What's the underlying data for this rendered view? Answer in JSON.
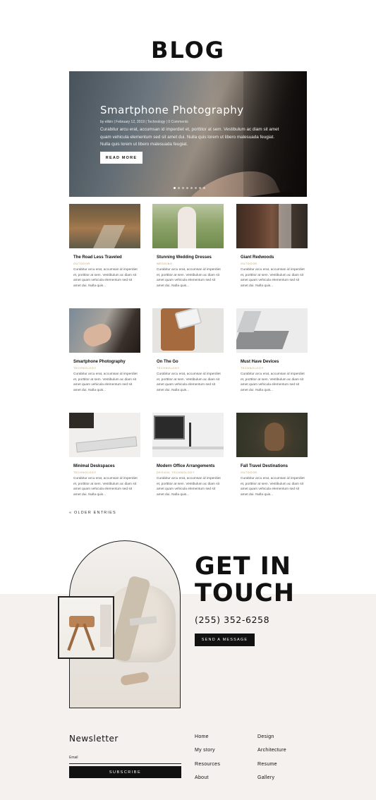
{
  "page_title": "BLOG",
  "hero": {
    "title": "Smartphone Photography",
    "meta": "by elikin | February 12, 2019 | Technology | 0 Comments",
    "excerpt": "Curabitur arcu erat, accumsan id imperdiet et, porttitor at sem. Vestibulum ac diam sit amet quam vehicula elementum sed sit amet dui. Nulla quis lorem ut libero malesuada feugiat. Nulla quis lorem ut libero malesuada feugiat.",
    "button_label": "READ MORE",
    "slide_count": 8,
    "active_slide": 1
  },
  "posts": [
    {
      "title": "The Road Less Traveled",
      "category": "OUTDOOR",
      "excerpt": "Curabitur arcu erat, accumsan id imperdiet et, porttitor at sem. Vestibulum ac diam sit amet quam vehicula elementum sed sit amet dui. Nulla quis..."
    },
    {
      "title": "Stunning Wedding Dresses",
      "category": "WEDDING",
      "excerpt": "Curabitur arcu erat, accumsan id imperdiet et, porttitor at sem. Vestibulum ac diam sit amet quam vehicula elementum sed sit amet dui. Nulla quis..."
    },
    {
      "title": "Giant Redwoods",
      "category": "OUTDOOR",
      "excerpt": "Curabitur arcu erat, accumsan id imperdiet et, porttitor at sem. Vestibulum ac diam sit amet quam vehicula elementum sed sit amet dui. Nulla quis..."
    },
    {
      "title": "Smartphone Photography",
      "category": "TECHNOLOGY",
      "excerpt": "Curabitur arcu erat, accumsan id imperdiet et, porttitor at sem. Vestibulum ac diam sit amet quam vehicula elementum sed sit amet dui. Nulla quis..."
    },
    {
      "title": "On The Go",
      "category": "TECHNOLOGY",
      "excerpt": "Curabitur arcu erat, accumsan id imperdiet et, porttitor at sem. Vestibulum ac diam sit amet quam vehicula elementum sed sit amet dui. Nulla quis..."
    },
    {
      "title": "Must Have Devices",
      "category": "TECHNOLOGY",
      "excerpt": "Curabitur arcu erat, accumsan id imperdiet et, porttitor at sem. Vestibulum ac diam sit amet quam vehicula elementum sed sit amet dui. Nulla quis..."
    },
    {
      "title": "Minimal Deskspaces",
      "category": "TECHNOLOGY",
      "excerpt": "Curabitur arcu erat, accumsan id imperdiet et, porttitor at sem. Vestibulum ac diam sit amet quam vehicula elementum sed sit amet dui. Nulla quis..."
    },
    {
      "title": "Modern Office Arrangements",
      "category": "DESIGN, TECHNOLOGY",
      "excerpt": "Curabitur arcu erat, accumsan id imperdiet et, porttitor at sem. Vestibulum ac diam sit amet quam vehicula elementum sed sit amet dui. Nulla quis..."
    },
    {
      "title": "Fall Travel Destinations",
      "category": "OUTDOOR",
      "excerpt": "Curabitur arcu erat, accumsan id imperdiet et, porttitor at sem. Vestibulum ac diam sit amet quam vehicula elementum sed sit amet dui. Nulla quis..."
    }
  ],
  "older_entries": "« OLDER ENTRIES",
  "contact": {
    "heading_line1": "GET IN",
    "heading_line2": "TOUCH",
    "phone": "(255) 352-6258",
    "button_label": "SEND A MESSAGE"
  },
  "newsletter": {
    "title": "Newsletter",
    "email_label": "Email",
    "email_value": "",
    "button_label": "SUBSCRIBE"
  },
  "footer_links": {
    "col1": [
      "Home",
      "My story",
      "Resources",
      "About"
    ],
    "col2": [
      "Design",
      "Architecture",
      "Resume",
      "Gallery"
    ]
  },
  "colors": {
    "accent": "#b59a6a",
    "dark": "#111111",
    "contact_bg": "#f4f1ee"
  }
}
